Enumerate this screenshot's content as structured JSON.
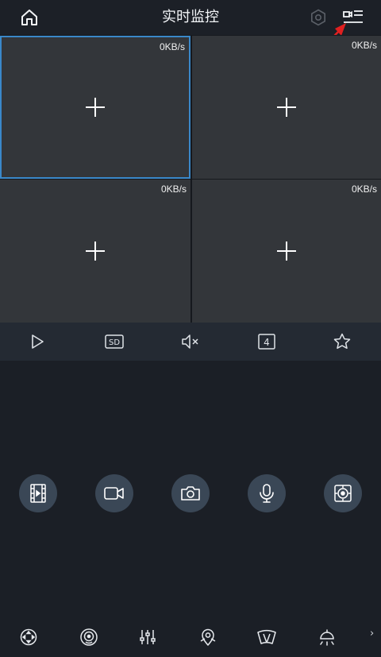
{
  "header": {
    "title": "实时监控",
    "icons": {
      "home": "home-icon",
      "settings": "settings-icon",
      "layout": "camera-list-icon"
    }
  },
  "grid": {
    "cells": [
      {
        "rate": "0KB/s",
        "selected": true
      },
      {
        "rate": "0KB/s",
        "selected": false
      },
      {
        "rate": "0KB/s",
        "selected": false
      },
      {
        "rate": "0KB/s",
        "selected": false
      }
    ]
  },
  "toolbar": {
    "items": [
      "play-icon",
      "sd-quality-icon",
      "mute-icon",
      "split-count-icon",
      "favorite-star-icon"
    ],
    "sd_label": "SD",
    "split_label": "4"
  },
  "actions": [
    "video-playback-icon",
    "record-icon",
    "snapshot-icon",
    "microphone-icon",
    "lens-control-icon"
  ],
  "bottom_bar": {
    "items": [
      "ptz-direction-icon",
      "fisheye-icon",
      "image-adjust-icon",
      "preset-point-icon",
      "wiper-icon",
      "light-icon"
    ],
    "more": "›"
  },
  "colors": {
    "background": "#1b1f26",
    "cell": "#33363a",
    "selected_border": "#3a88c9",
    "toolbar": "#242a33",
    "action_circle": "#3a4756",
    "annotation_arrow": "#e02020"
  }
}
